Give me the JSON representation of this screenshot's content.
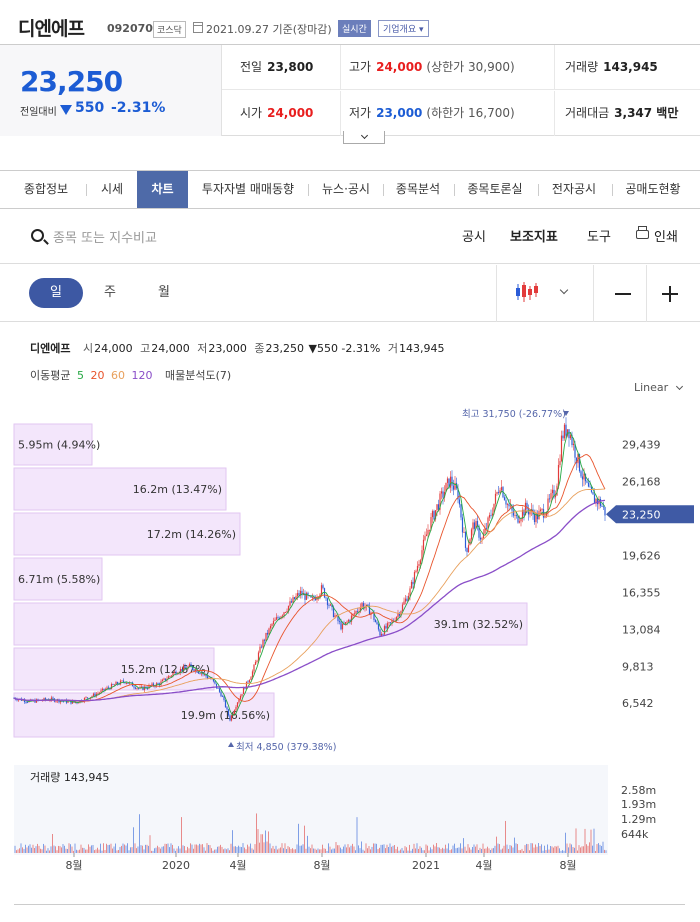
{
  "header": {
    "name": "디엔에프",
    "code": "092070",
    "market": "코스닥",
    "date": "2021.09.27 기준(장마감)",
    "realtime": "실시간",
    "company_btn": "기업개요 ▾"
  },
  "price": {
    "current": "23,250",
    "compare_label": "전일대비",
    "change": "550",
    "change_rate": "-2.31%"
  },
  "info": {
    "prev_close_label": "전일",
    "prev_close": "23,800",
    "high_label": "고가",
    "high": "24,000",
    "upper_limit": "(상한가 30,900)",
    "volume_label": "거래량",
    "volume": "143,945",
    "open_label": "시가",
    "open": "24,000",
    "low_label": "저가",
    "low": "23,000",
    "lower_limit": "(하한가 16,700)",
    "trade_value_label": "거래대금",
    "trade_value": "3,347 백만"
  },
  "tabs": [
    "종합정보",
    "시세",
    "차트",
    "투자자별 매매동향",
    "뉴스·공시",
    "종목분석",
    "종목토론실",
    "전자공시",
    "공매도현황"
  ],
  "toolbar": {
    "search_placeholder": "종목 또는 지수비교",
    "disclosure": "공시",
    "indicator": "보조지표",
    "tools": "도구",
    "print": "인쇄"
  },
  "periods": [
    "일",
    "주",
    "월"
  ],
  "ohlc": {
    "name": "디엔에프",
    "open_label": "시",
    "open": "24,000",
    "high_label": "고",
    "high": "24,000",
    "low_label": "저",
    "low": "23,000",
    "close_label": "종",
    "close": "23,250",
    "change": "▼550 -2.31%",
    "vol_label": "거",
    "vol": "143,945"
  },
  "ma_legend": {
    "label": "이동평균",
    "ma5": "5",
    "ma20": "20",
    "ma60": "60",
    "ma120": "120",
    "vp_label": "매물분석도(7)"
  },
  "scale_mode": "Linear",
  "chart_data": {
    "type": "candlestick",
    "y_ticks": [
      "29,439",
      "26,168",
      "19,626",
      "16,355",
      "13,084",
      "9,813",
      "6,542"
    ],
    "current_tag": "23,250",
    "max_label": "최고 31,750 (-26.77%)",
    "min_label": "최저 4,850 (379.38%)",
    "x_labels": [
      "8월",
      "2020",
      "4월",
      "8월",
      "2021",
      "4월",
      "8월"
    ],
    "volume_profile": [
      {
        "label": "5.95m (4.94%)"
      },
      {
        "label": "16.2m (13.47%)"
      },
      {
        "label": "17.2m (14.26%)"
      },
      {
        "label": "6.71m (5.58%)"
      },
      {
        "label": "39.1m (32.52%)"
      },
      {
        "label": "15.2m (12.67%)"
      },
      {
        "label": "19.9m (16.56%)"
      }
    ],
    "volume_title": "거래량 143,945",
    "volume_ticks": [
      "2.58m",
      "1.93m",
      "1.29m",
      "644k"
    ],
    "colors": {
      "ma5": "#27a844",
      "ma20": "#e8542c",
      "ma60": "#e8a05c",
      "ma120": "#8a4ec8",
      "up": "#e23b3b",
      "down": "#2a5bd7",
      "vp": "#f3e6fb",
      "tag": "#3f5aa5"
    }
  }
}
